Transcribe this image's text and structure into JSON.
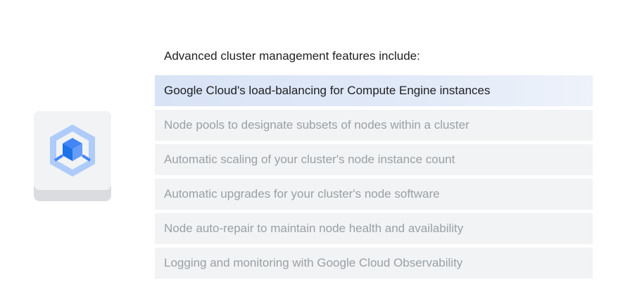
{
  "heading": "Advanced cluster management features include:",
  "product_icon": "kubernetes-engine-icon",
  "colors": {
    "icon_blue": "#4285f4",
    "icon_light_blue": "#aecbfa",
    "active_row": "#d8e3f5",
    "inactive_row": "#f1f3f4",
    "inactive_text": "#9aa0a6",
    "active_text": "#202124"
  },
  "features": [
    {
      "label": "Google Cloud's load-balancing for Compute Engine instances",
      "active": true
    },
    {
      "label": "Node pools to designate subsets of nodes within a cluster",
      "active": false
    },
    {
      "label": "Automatic scaling of your cluster's node instance count",
      "active": false
    },
    {
      "label": "Automatic upgrades for your cluster's node software",
      "active": false
    },
    {
      "label": "Node auto-repair to maintain node health and availability",
      "active": false
    },
    {
      "label": "Logging and monitoring with Google Cloud Observability",
      "active": false
    }
  ]
}
